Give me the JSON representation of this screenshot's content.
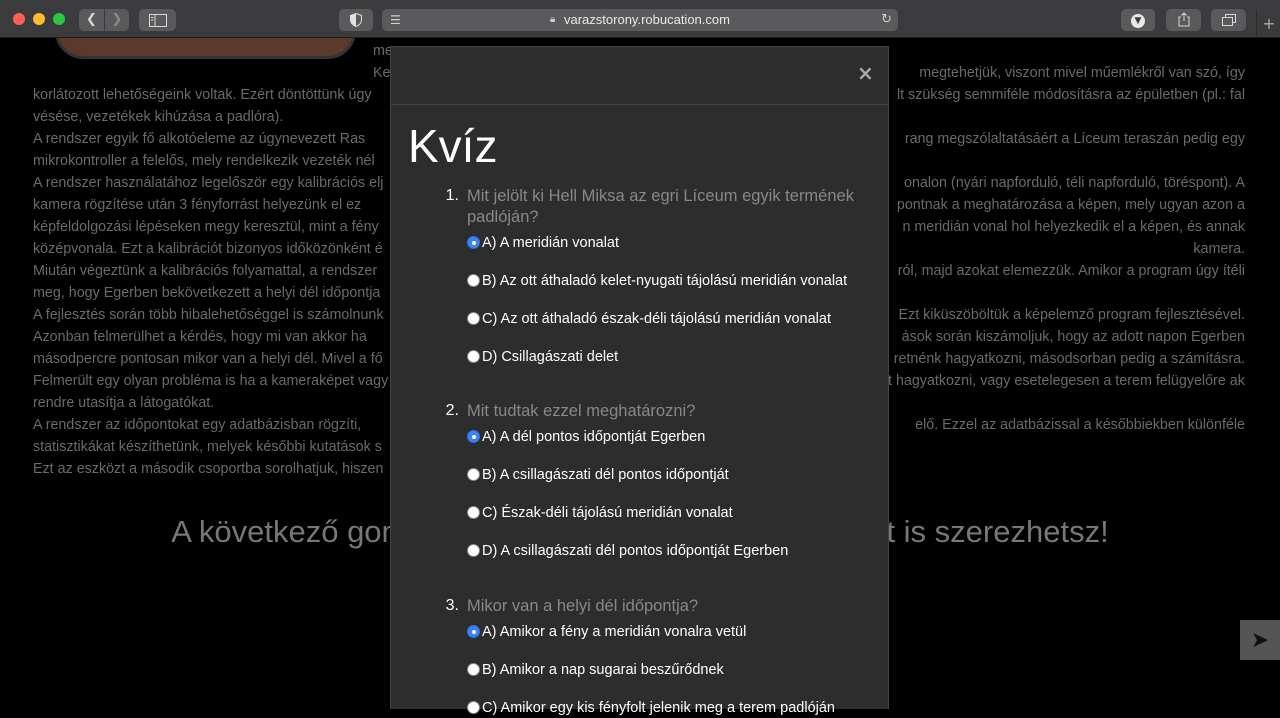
{
  "browser": {
    "address": "varazstorony.robucation.com",
    "icons": {
      "back": "chevron-left-icon",
      "forward": "chevron-right-icon",
      "sidebar": "sidebar-icon",
      "privacy": "shield-icon",
      "reader": "reader-icon",
      "lock": "lock-icon",
      "reload": "reload-icon",
      "downloads": "download-icon",
      "share": "share-icon",
      "tabs": "tabs-icon",
      "new_tab": "plus-icon"
    }
  },
  "page": {
    "paragraph_lines": [
      "korlátozott lehetőségeink voltak. Ezért döntöttünk úgy",
      "vésése, vezetékek kihúzása a padlóra).",
      "A rendszer egyik fő alkotóeleme az úgynevezett Ras",
      "mikrokontroller a felelős, mely rendelkezik vezeték nél",
      "A rendszer használatához legelőször egy kalibrációs elj",
      "kamera rögzítése után 3 fényforrást helyezünk el ez",
      "képfeldolgozási lépéseken megy keresztül, mint a fény",
      "középvonala. Ezt a kalibrációt bizonyos időközönként é",
      "Miután végeztünk a kalibrációs folyamattal, a rendszer",
      "meg, hogy Egerben bekövetkezett a helyi dél időpontja",
      "A fejlesztés során több hibalehetőséggel is számolnunk",
      "Azonban felmerülhet a kérdés, hogy mi van akkor ha",
      "másodpercre pontosan mikor van a helyi dél. Mivel a fő",
      "Felmerült egy olyan probléma is ha a kameraképet vagy",
      "rendre utasítja a látogatókat.",
      "A rendszer az időpontokat egy adatbázisban rögzíti,",
      "statisztikákat készíthetünk, melyek későbbi kutatások s",
      "Ezt az eszközt a második csoportba sorolhatjuk, hiszen"
    ],
    "right_lines": [
      "megtehetjük, viszont mivel műemlékről van szó, így",
      "lt szükség semmiféle módosításra az épületben (pl.: fal",
      "",
      "rang megszólaltatásáért a Líceum teraszán pedig egy",
      "",
      "onalon (nyári napforduló, téli napforduló, töréspont). A",
      "pontnak a meghatározása a képen, mely ugyan azon a",
      "n meridián vonal hol helyezkedik el a képen, és annak",
      "kamera.",
      "ról, majd azokat elemezzük. Amikor a program úgy ítéli",
      "",
      "Ezt kiküszöböltük a képelemző program fejlesztésével.",
      "ások során kiszámoljuk, hogy az adott napon Egerben",
      "retnénk hagyatkozni, másodsorban pedig a számításra.",
      "t hagyatkozni, vagy esetelegesen a terem felügyelőre aki",
      "",
      "elő. Ezzel az adatbázissal a későbbiekben különféle",
      "",
      ""
    ],
    "top_partial_1": "me",
    "top_partial_2": "Ke",
    "cta": "A következő gomb megnyomásával további pontokat is szerezhetsz!",
    "scroll_top_icon": "arrow-up-icon"
  },
  "modal": {
    "close": "×",
    "title": "Kvíz",
    "questions": [
      {
        "number": "1.",
        "text": "Mit jelölt ki Hell Miksa az egri Líceum egyik termének padlóján?",
        "options": [
          {
            "label": "A) A meridián vonalat",
            "checked": true
          },
          {
            "label": "B) Az ott áthaladó kelet-nyugati tájolású meridián vonalat",
            "checked": false
          },
          {
            "label": "C) Az ott áthaladó észak-déli tájolású meridián vonalat",
            "checked": false
          },
          {
            "label": "D) Csillagászati delet",
            "checked": false
          }
        ]
      },
      {
        "number": "2.",
        "text": "Mit tudtak ezzel meghatározni?",
        "options": [
          {
            "label": "A) A dél pontos időpontját Egerben",
            "checked": true
          },
          {
            "label": "B) A csillagászati dél pontos időpontját",
            "checked": false
          },
          {
            "label": "C) Észak-déli tájolású meridián vonalat",
            "checked": false
          },
          {
            "label": "D) A csillagászati dél pontos időpontját Egerben",
            "checked": false
          }
        ]
      },
      {
        "number": "3.",
        "text": "Mikor van a helyi dél időpontja?",
        "options": [
          {
            "label": "A) Amikor a fény a meridián vonalra vetül",
            "checked": true
          },
          {
            "label": "B) Amikor a nap sugarai beszűrődnek",
            "checked": false
          },
          {
            "label": "C) Amikor egy kis fényfolt jelenik meg a terem padlóján",
            "checked": false
          }
        ]
      }
    ]
  }
}
